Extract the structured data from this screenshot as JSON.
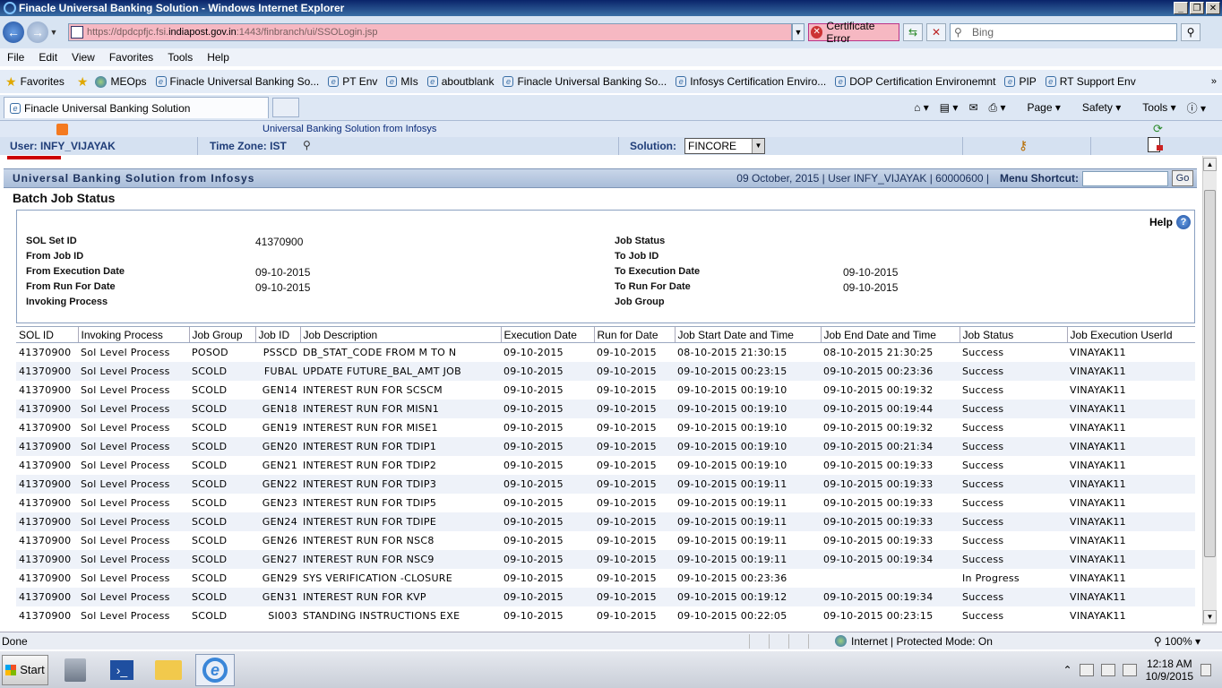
{
  "window": {
    "title": "Finacle Universal Banking Solution - Windows Internet Explorer"
  },
  "addressbar": {
    "url_prefix": "https://dpdcpfjc.fsi.",
    "url_domain": "indiapost.gov.in",
    "url_suffix": ":1443/finbranch/ui/SSOLogin.jsp",
    "cert_error": "Certificate Error",
    "search_placeholder": "Bing"
  },
  "menu": [
    "File",
    "Edit",
    "View",
    "Favorites",
    "Tools",
    "Help"
  ],
  "favorites": {
    "label": "Favorites",
    "items": [
      "MEOps",
      "Finacle Universal Banking So...",
      "PT Env",
      "MIs",
      "aboutblank",
      "Finacle Universal Banking So...",
      "Infosys Certification Enviro...",
      "DOP Certification Environemnt",
      "PIP",
      "RT Support Env"
    ]
  },
  "tab": {
    "title": "Finacle Universal Banking Solution"
  },
  "commandbar": {
    "page": "Page",
    "safety": "Safety",
    "tools": "Tools"
  },
  "finacle": {
    "header_text": "Universal Banking Solution from Infosys",
    "user": "User: INFY_VIJAYAK",
    "timezone": "Time Zone: IST",
    "solution_label": "Solution:",
    "solution_value": "FINCORE",
    "ubs_label": "Universal Banking Solution from Infosys",
    "date_info": "09 October, 2015  |  User  INFY_VIJAYAK  |  60000600  |",
    "menu_shortcut_label": "Menu Shortcut:",
    "go_label": "Go"
  },
  "page": {
    "title": "Batch Job Status",
    "help": "Help",
    "criteria": {
      "sol_set_id_label": "SOL Set ID",
      "sol_set_id": "41370900",
      "from_job_id_label": "From Job ID",
      "from_exec_date_label": "From Execution Date",
      "from_exec_date": "09-10-2015",
      "from_run_date_label": "From Run For Date",
      "from_run_date": "09-10-2015",
      "invoking_process_label": "Invoking Process",
      "job_status_label": "Job Status",
      "to_job_id_label": "To Job ID",
      "to_exec_date_label": "To Execution Date",
      "to_exec_date": "09-10-2015",
      "to_run_date_label": "To Run For Date",
      "to_run_date": "09-10-2015",
      "job_group_label": "Job Group"
    },
    "columns": [
      "SOL ID",
      "Invoking Process",
      "Job Group",
      "Job ID",
      "Job Description",
      "Execution Date",
      "Run for Date",
      "Job Start Date and Time",
      "Job End Date and Time",
      "Job Status",
      "Job Execution UserId"
    ],
    "rows": [
      [
        "41370900",
        "Sol Level Process",
        "POSOD",
        "PSSCD",
        "DB_STAT_CODE FROM M TO N",
        "09-10-2015",
        "09-10-2015",
        "08-10-2015 21:30:15",
        "08-10-2015 21:30:25",
        "Success",
        "VINAYAK11"
      ],
      [
        "41370900",
        "Sol Level Process",
        "SCOLD",
        "FUBAL",
        "UPDATE FUTURE_BAL_AMT JOB",
        "09-10-2015",
        "09-10-2015",
        "09-10-2015 00:23:15",
        "09-10-2015 00:23:36",
        "Success",
        "VINAYAK11"
      ],
      [
        "41370900",
        "Sol Level Process",
        "SCOLD",
        "GEN14",
        "INTEREST RUN FOR SCSCM",
        "09-10-2015",
        "09-10-2015",
        "09-10-2015 00:19:10",
        "09-10-2015 00:19:32",
        "Success",
        "VINAYAK11"
      ],
      [
        "41370900",
        "Sol Level Process",
        "SCOLD",
        "GEN18",
        "INTEREST RUN FOR MISN1",
        "09-10-2015",
        "09-10-2015",
        "09-10-2015 00:19:10",
        "09-10-2015 00:19:44",
        "Success",
        "VINAYAK11"
      ],
      [
        "41370900",
        "Sol Level Process",
        "SCOLD",
        "GEN19",
        "INTEREST RUN FOR MISE1",
        "09-10-2015",
        "09-10-2015",
        "09-10-2015 00:19:10",
        "09-10-2015 00:19:32",
        "Success",
        "VINAYAK11"
      ],
      [
        "41370900",
        "Sol Level Process",
        "SCOLD",
        "GEN20",
        "INTEREST RUN FOR TDIP1",
        "09-10-2015",
        "09-10-2015",
        "09-10-2015 00:19:10",
        "09-10-2015 00:21:34",
        "Success",
        "VINAYAK11"
      ],
      [
        "41370900",
        "Sol Level Process",
        "SCOLD",
        "GEN21",
        "INTEREST RUN FOR TDIP2",
        "09-10-2015",
        "09-10-2015",
        "09-10-2015 00:19:10",
        "09-10-2015 00:19:33",
        "Success",
        "VINAYAK11"
      ],
      [
        "41370900",
        "Sol Level Process",
        "SCOLD",
        "GEN22",
        "INTEREST RUN FOR TDIP3",
        "09-10-2015",
        "09-10-2015",
        "09-10-2015 00:19:11",
        "09-10-2015 00:19:33",
        "Success",
        "VINAYAK11"
      ],
      [
        "41370900",
        "Sol Level Process",
        "SCOLD",
        "GEN23",
        "INTEREST RUN FOR TDIP5",
        "09-10-2015",
        "09-10-2015",
        "09-10-2015 00:19:11",
        "09-10-2015 00:19:33",
        "Success",
        "VINAYAK11"
      ],
      [
        "41370900",
        "Sol Level Process",
        "SCOLD",
        "GEN24",
        "INTEREST RUN FOR TDIPE",
        "09-10-2015",
        "09-10-2015",
        "09-10-2015 00:19:11",
        "09-10-2015 00:19:33",
        "Success",
        "VINAYAK11"
      ],
      [
        "41370900",
        "Sol Level Process",
        "SCOLD",
        "GEN26",
        "INTEREST RUN FOR NSC8",
        "09-10-2015",
        "09-10-2015",
        "09-10-2015 00:19:11",
        "09-10-2015 00:19:33",
        "Success",
        "VINAYAK11"
      ],
      [
        "41370900",
        "Sol Level Process",
        "SCOLD",
        "GEN27",
        "INTEREST RUN FOR NSC9",
        "09-10-2015",
        "09-10-2015",
        "09-10-2015 00:19:11",
        "09-10-2015 00:19:34",
        "Success",
        "VINAYAK11"
      ],
      [
        "41370900",
        "Sol Level Process",
        "SCOLD",
        "GEN29",
        "SYS VERIFICATION -CLOSURE",
        "09-10-2015",
        "09-10-2015",
        "09-10-2015 00:23:36",
        "",
        "In Progress",
        "VINAYAK11"
      ],
      [
        "41370900",
        "Sol Level Process",
        "SCOLD",
        "GEN31",
        "INTEREST RUN FOR KVP",
        "09-10-2015",
        "09-10-2015",
        "09-10-2015 00:19:12",
        "09-10-2015 00:19:34",
        "Success",
        "VINAYAK11"
      ],
      [
        "41370900",
        "Sol Level Process",
        "SCOLD",
        "SI003",
        "STANDING INSTRUCTIONS EXE",
        "09-10-2015",
        "09-10-2015",
        "09-10-2015 00:22:05",
        "09-10-2015 00:23:15",
        "Success",
        "VINAYAK11"
      ]
    ]
  },
  "statusbar": {
    "text": "Done",
    "zone": "Internet | Protected Mode: On",
    "zoom": "100%"
  },
  "taskbar": {
    "start": "Start",
    "time": "12:18 AM",
    "date": "10/9/2015"
  }
}
